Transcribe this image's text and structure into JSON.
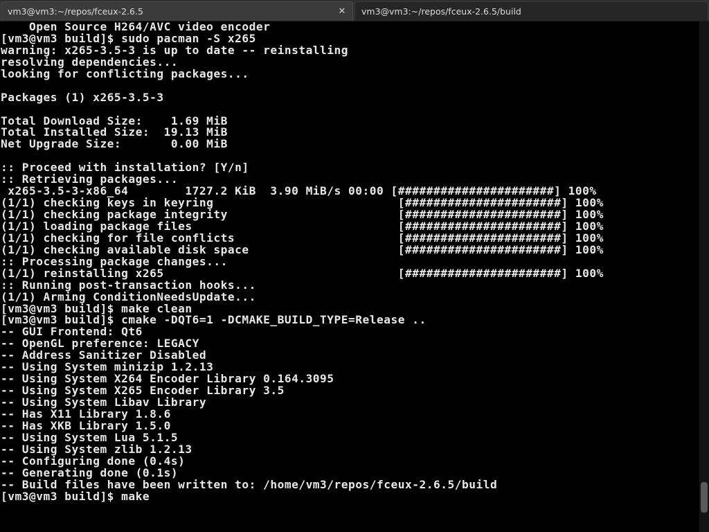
{
  "tabs": [
    {
      "title": "vm3@vm3:~/repos/fceux-2.6.5",
      "close_glyph": "✕",
      "active": true
    },
    {
      "title": "vm3@vm3:~/repos/fceux-2.6.5/build",
      "close_glyph": "✕",
      "active": false
    }
  ],
  "terminal": {
    "lines": [
      "    Open Source H264/AVC video encoder",
      "[vm3@vm3 build]$ sudo pacman -S x265",
      "warning: x265-3.5-3 is up to date -- reinstalling",
      "resolving dependencies...",
      "looking for conflicting packages...",
      "",
      "Packages (1) x265-3.5-3",
      "",
      "Total Download Size:    1.69 MiB",
      "Total Installed Size:  19.13 MiB",
      "Net Upgrade Size:       0.00 MiB",
      "",
      ":: Proceed with installation? [Y/n]",
      ":: Retrieving packages...",
      " x265-3.5-3-x86_64        1727.2 KiB  3.90 MiB/s 00:00 [######################] 100%",
      "(1/1) checking keys in keyring                          [######################] 100%",
      "(1/1) checking package integrity                        [######################] 100%",
      "(1/1) loading package files                             [######################] 100%",
      "(1/1) checking for file conflicts                       [######################] 100%",
      "(1/1) checking available disk space                     [######################] 100%",
      ":: Processing package changes...",
      "(1/1) reinstalling x265                                 [######################] 100%",
      ":: Running post-transaction hooks...",
      "(1/1) Arming ConditionNeedsUpdate...",
      "[vm3@vm3 build]$ make clean",
      "[vm3@vm3 build]$ cmake -DQT6=1 -DCMAKE_BUILD_TYPE=Release ..",
      "-- GUI Frontend: Qt6",
      "-- OpenGL preference: LEGACY",
      "-- Address Sanitizer Disabled",
      "-- Using System minizip 1.2.13",
      "-- Using System X264 Encoder Library 0.164.3095",
      "-- Using System X265 Encoder Library 3.5",
      "-- Using System Libav Library",
      "-- Has X11 Library 1.8.6",
      "-- Has XKB Library 1.5.0",
      "-- Using System Lua 5.1.5",
      "-- Using System zlib 1.2.13",
      "-- Configuring done (0.4s)",
      "-- Generating done (0.1s)",
      "-- Build files have been written to: /home/vm3/repos/fceux-2.6.5/build",
      "[vm3@vm3 build]$ make"
    ]
  },
  "scrollbar": {
    "position": 0.96,
    "visible_fraction": 0.06
  },
  "colors": {
    "terminal_bg": "#000000",
    "terminal_fg": "#e8e8e8",
    "tabbar_bg": "#2f2f2f",
    "active_tab_bg": "#3b3b3b",
    "inactive_tab_bg": "#262626"
  }
}
